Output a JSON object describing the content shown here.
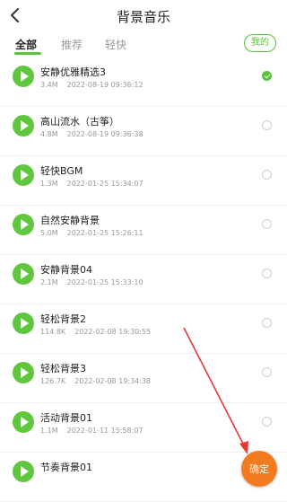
{
  "header": {
    "title": "背景音乐",
    "back_icon": "chevron-left-icon"
  },
  "tabs": [
    {
      "label": "全部",
      "active": true
    },
    {
      "label": "推荐",
      "active": false
    },
    {
      "label": "轻快",
      "active": false
    }
  ],
  "mine_button": {
    "label": "我的"
  },
  "tracks": [
    {
      "name": "安静优雅精选3",
      "size": "3.4M",
      "date": "2022-08-19 09:36:12",
      "selected": true
    },
    {
      "name": "高山流水（古筝）",
      "size": "4.8M",
      "date": "2022-08-19 09:36:38",
      "selected": false
    },
    {
      "name": "轻快BGM",
      "size": "1.3M",
      "date": "2022-01-25 15:34:07",
      "selected": false
    },
    {
      "name": "自然安静背景",
      "size": "5.0M",
      "date": "2022-01-25 15:26:11",
      "selected": false
    },
    {
      "name": "安静背景04",
      "size": "2.1M",
      "date": "2022-01-25 15:33:10",
      "selected": false
    },
    {
      "name": "轻松背景2",
      "size": "114.8K",
      "date": "2022-02-08 19:30:55",
      "selected": false
    },
    {
      "name": "轻松背景3",
      "size": "126.7K",
      "date": "2022-02-08 19:34:38",
      "selected": false
    },
    {
      "name": "活动背景01",
      "size": "1.1M",
      "date": "2022-01-11 15:58:07",
      "selected": false
    },
    {
      "name": "节奏背景01",
      "size": "",
      "date": "",
      "selected": false
    }
  ],
  "confirm_button": {
    "label": "确定"
  },
  "colors": {
    "accent": "#57c23a",
    "confirm": "#f27b1f",
    "annotation": "#e53935"
  }
}
